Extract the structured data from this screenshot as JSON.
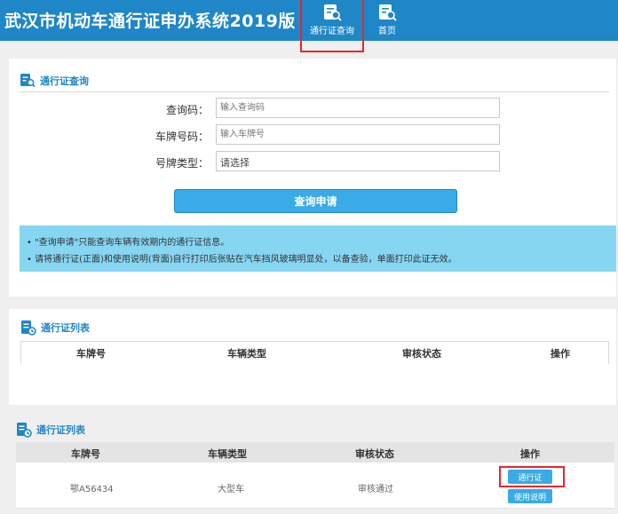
{
  "header": {
    "title": "武汉市机动车通行证申办系统2019版",
    "nav": [
      {
        "label": "通行证查询",
        "icon": "document-search-icon",
        "active": true
      },
      {
        "label": "首页",
        "icon": "document-search-icon",
        "active": false
      }
    ],
    "color": "#1f86c8"
  },
  "query_panel": {
    "title": "通行证查询",
    "fields": [
      {
        "label": "查询码：",
        "placeholder": "输入查询码",
        "value": ""
      },
      {
        "label": "车牌号码：",
        "placeholder": "输入车牌号",
        "value": ""
      },
      {
        "label": "号牌类型：",
        "value": "请选择"
      }
    ],
    "button": "查询申请",
    "notices": [
      "\"查询申请\"只能查询车辆有效期内的通行证信息。",
      "请将通行证(正面)和使用说明(背面)自行打印后张贴在汽车挡风玻璃明显处，以备查验，单面打印此证无效。"
    ]
  },
  "list1": {
    "title": "通行证列表",
    "columns": [
      "车牌号",
      "车辆类型",
      "审核状态",
      "操作"
    ]
  },
  "list2": {
    "title": "通行证列表",
    "columns": [
      "车牌号",
      "车辆类型",
      "审核状态",
      "操作"
    ],
    "rows": [
      {
        "plate": "鄂A56434",
        "type": "大型车",
        "status": "审核通过",
        "actions": [
          "通行证",
          "使用说明"
        ]
      }
    ]
  },
  "colors": {
    "accent": "#1f86c8",
    "button": "#3aabe6",
    "notice_bg": "#86d6f2",
    "highlight": "#e8262a"
  }
}
